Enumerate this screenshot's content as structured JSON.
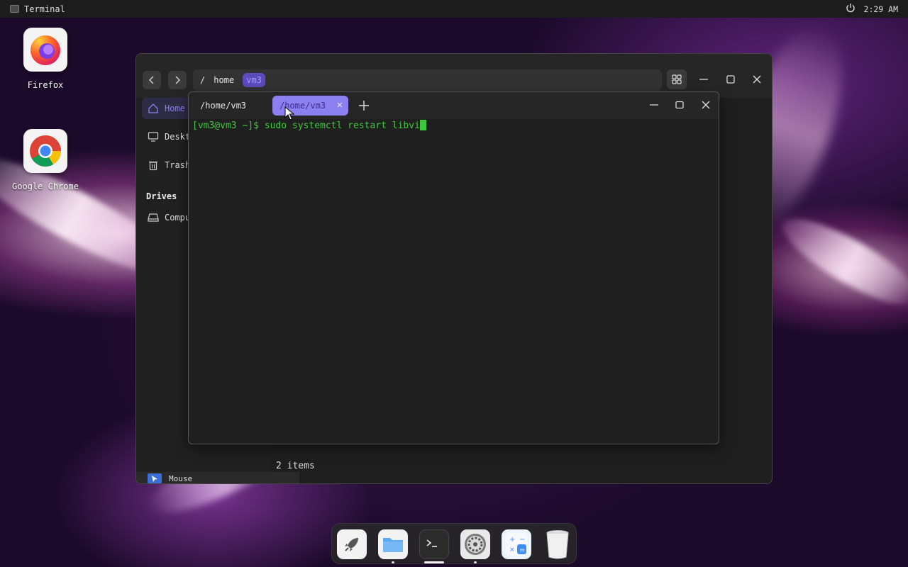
{
  "topbar": {
    "app_name": "Terminal",
    "clock": "2:29 AM",
    "power_icon": "power-icon"
  },
  "desktop": {
    "icons": [
      {
        "label": "Firefox",
        "icon": "firefox-icon"
      },
      {
        "label": "Google Chrome",
        "icon": "chrome-icon"
      }
    ]
  },
  "file_manager": {
    "path": [
      "/",
      "home",
      "vm3"
    ],
    "sidebar": {
      "items": [
        {
          "label": "Home",
          "icon": "home-icon"
        },
        {
          "label": "Deskt",
          "icon": "desktop-icon"
        },
        {
          "label": "Trash",
          "icon": "trash-icon"
        }
      ],
      "drives_heading": "Drives",
      "drives": [
        {
          "label": "Compu",
          "icon": "drive-icon"
        }
      ]
    },
    "status": "2 items",
    "bottom_label": "Mouse"
  },
  "terminal": {
    "tabs": [
      {
        "label": "/home/vm3",
        "active": false
      },
      {
        "label": "/home/vm3",
        "active": true
      }
    ],
    "prompt": "[vm3@vm3 ~]$ ",
    "command": "sudo systemctl restart libvi"
  },
  "dock": {
    "items": [
      {
        "name": "launcher",
        "icon": "rocket-icon"
      },
      {
        "name": "files",
        "icon": "folder-icon"
      },
      {
        "name": "terminal",
        "icon": "terminal-icon"
      },
      {
        "name": "settings",
        "icon": "settings-icon"
      },
      {
        "name": "calculator",
        "icon": "calculator-icon"
      },
      {
        "name": "trash",
        "icon": "trash-bin-icon"
      }
    ]
  },
  "colors": {
    "accent": "#8c7ff0",
    "terminal_text": "#3fc83f"
  }
}
